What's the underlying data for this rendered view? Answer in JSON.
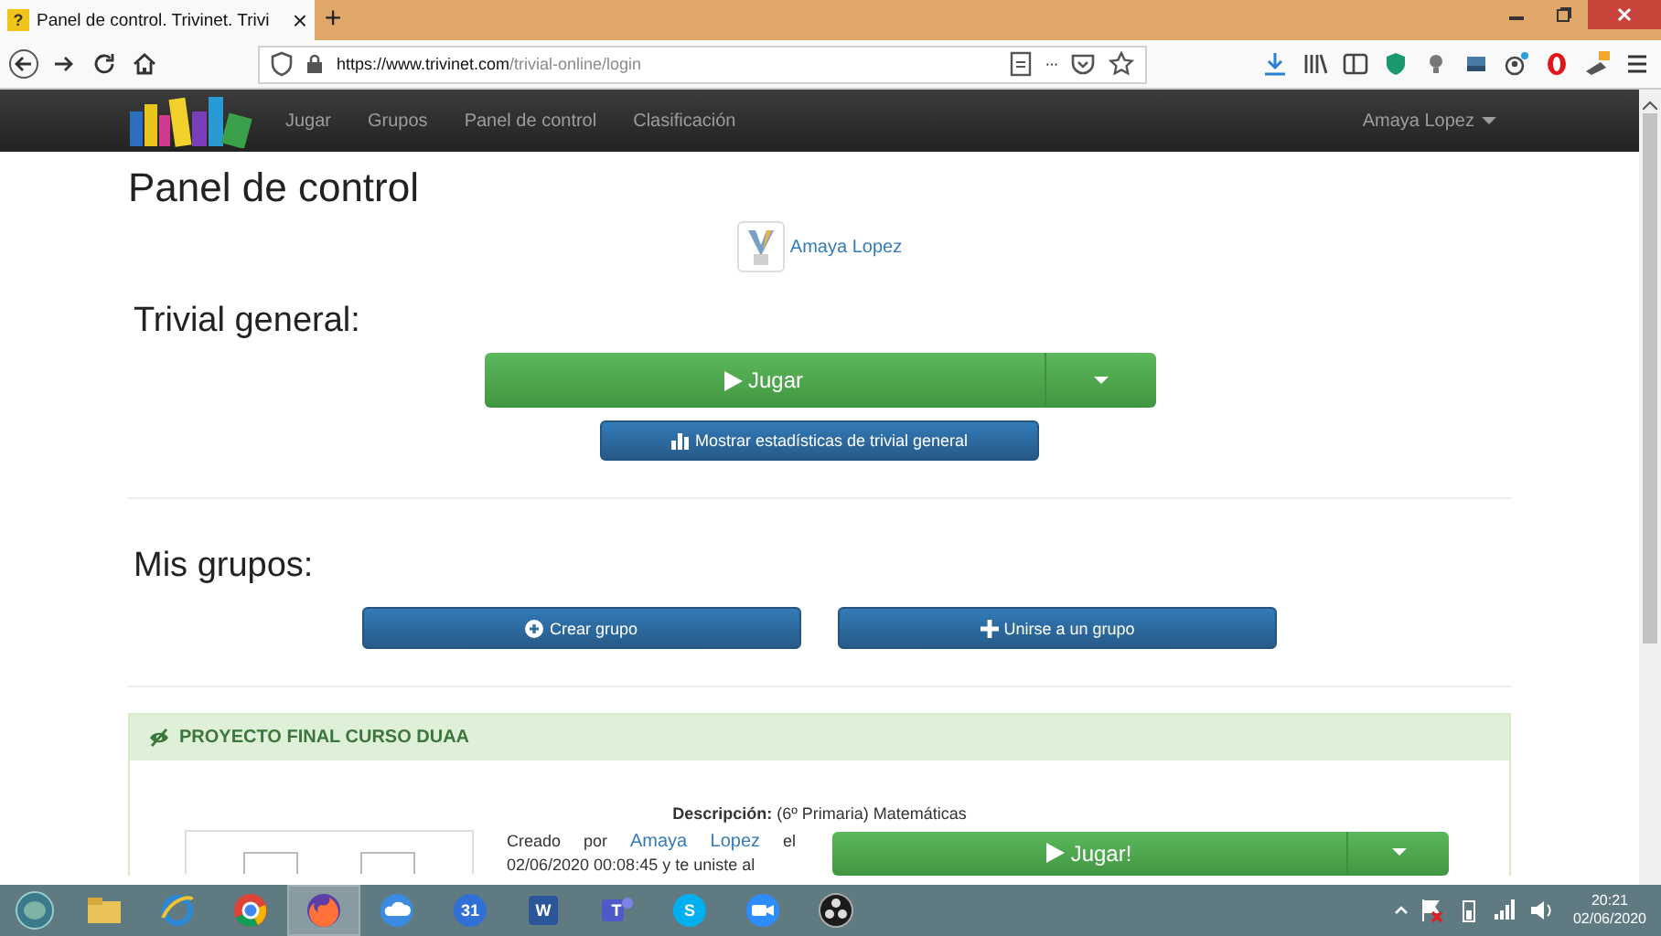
{
  "browser": {
    "tab": {
      "icon": "?",
      "title": "Panel de control. Trivinet. Trivi",
      "close": "×"
    },
    "new_tab": "+",
    "url_host": "https://www.trivinet.com",
    "url_path": "/trivial-online/login",
    "more": "···"
  },
  "navbar": {
    "items": [
      {
        "label": "Jugar"
      },
      {
        "label": "Grupos"
      },
      {
        "label": "Panel de control"
      },
      {
        "label": "Clasificación"
      }
    ],
    "user": "Amaya Lopez"
  },
  "page": {
    "title": "Panel de control",
    "profile_name": "Amaya Lopez",
    "general": {
      "heading": "Trivial general:",
      "play": "Jugar",
      "stats": "Mostrar estadísticas de trivial general"
    },
    "groups": {
      "heading": "Mis grupos:",
      "create": "Crear grupo",
      "join": "Unirse a un grupo",
      "panel": {
        "title": "PROYECTO FINAL CURSO DUAA",
        "description_label": "Descripción:",
        "description": "(6º Primaria) Matemáticas",
        "created_before": "Creado por",
        "creator": "Amaya Lopez",
        "created_after": "el 02/06/2020 00:08:45 y te uniste al",
        "play": "Jugar!"
      }
    }
  },
  "taskbar": {
    "apps": [
      {
        "kind": "folder",
        "selected": false
      },
      {
        "kind": "ie",
        "selected": false
      },
      {
        "kind": "chrome",
        "selected": false
      },
      {
        "kind": "firefox",
        "selected": true
      },
      {
        "kind": "cloud",
        "selected": false
      },
      {
        "kind": "calendar",
        "label": "31",
        "selected": false
      },
      {
        "kind": "word",
        "label": "W",
        "selected": false
      },
      {
        "kind": "teams",
        "label": "T",
        "selected": false
      },
      {
        "kind": "skype",
        "label": "S",
        "selected": false
      },
      {
        "kind": "zoom",
        "selected": false
      },
      {
        "kind": "obs",
        "selected": false
      }
    ],
    "time": "20:21",
    "date": "02/06/2020"
  }
}
